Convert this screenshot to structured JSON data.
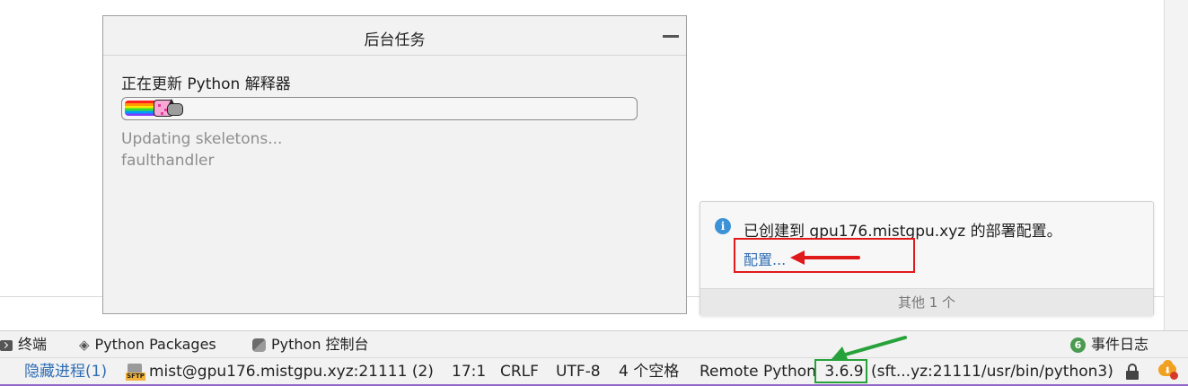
{
  "background_tasks": {
    "title": "后台任务",
    "task_name": "正在更新 Python 解释器",
    "progress_detail_1": "Updating skeletons...",
    "progress_detail_2": "faulthandler"
  },
  "notification": {
    "message": "已创建到 gpu176.mistgpu.xyz 的部署配置。",
    "link_label": "配置...",
    "footer_label": "其他 1 个",
    "highlight_color": "#e0191b"
  },
  "tool_windows": {
    "terminal_label": "终端",
    "packages_label": "Python Packages",
    "console_label": "Python 控制台",
    "event_log_count": "6",
    "event_log_label": "事件日志"
  },
  "status_bar": {
    "hidden_processes": "隐藏进程(1)",
    "sftp_icon_text": "SFTP",
    "deployment_server": "mist@gpu176.mistgpu.xyz:21111 (2)",
    "cursor_position": "17:1",
    "line_separator": "CRLF",
    "encoding": "UTF-8",
    "indent": "4 个空格",
    "interpreter_prefix": "Remote Python",
    "interpreter_version": "3.6.9",
    "interpreter_path": "(sft...yz:21111/usr/bin/python3)",
    "version_highlight_color": "#27a23a"
  }
}
